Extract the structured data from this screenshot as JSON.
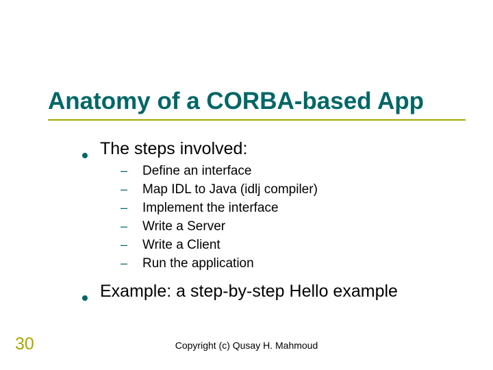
{
  "title": "Anatomy of a CORBA-based App",
  "bullets": {
    "b0": "The steps involved:",
    "b1": "Example: a step-by-step Hello example"
  },
  "sub": {
    "s0": "Define an interface",
    "s1": "Map IDL to Java (idlj compiler)",
    "s2": "Implement the interface",
    "s3": "Write a Server",
    "s4": "Write a Client",
    "s5": "Run the application"
  },
  "slide_number": "30",
  "copyright": "Copyright (c) Qusay H. Mahmoud"
}
